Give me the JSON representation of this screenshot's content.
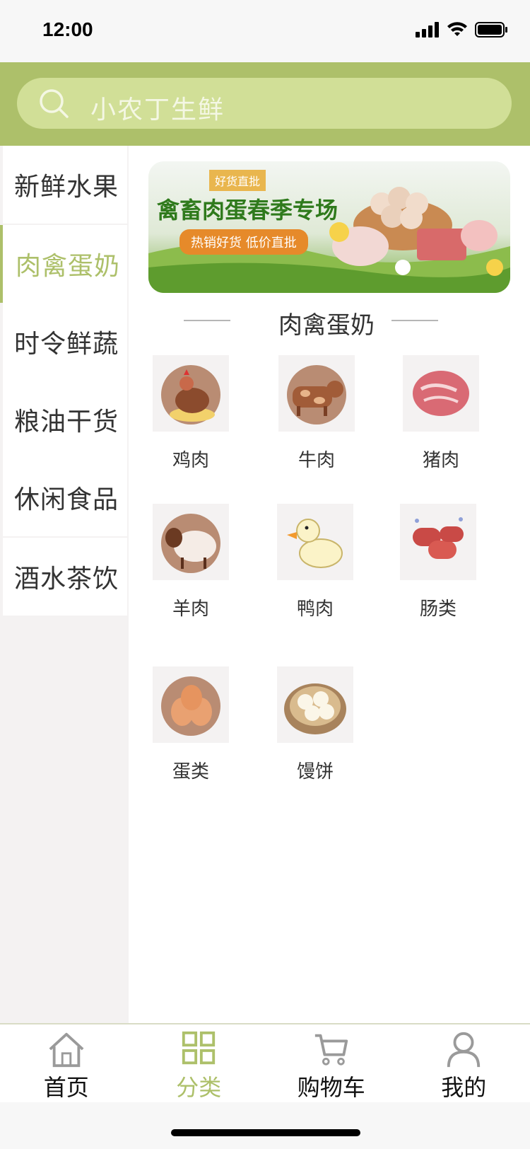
{
  "status": {
    "time": "12:00"
  },
  "search": {
    "placeholder": "小农丁生鲜"
  },
  "sidebar": {
    "items": [
      {
        "label": "新鲜水果",
        "active": false
      },
      {
        "label": "肉禽蛋奶",
        "active": true
      },
      {
        "label": "时令鲜蔬",
        "active": false
      },
      {
        "label": "粮油干货",
        "active": false
      },
      {
        "label": "休闲食品",
        "active": false
      },
      {
        "label": "酒水茶饮",
        "active": false
      }
    ]
  },
  "banner": {
    "tag": "好货直批",
    "title": "禽畜肉蛋春季专场",
    "subtitle": "热销好货 低价直批"
  },
  "section": {
    "title": "肉禽蛋奶"
  },
  "categories": [
    {
      "label": "鸡肉",
      "icon": "chicken-icon"
    },
    {
      "label": "牛肉",
      "icon": "cow-icon"
    },
    {
      "label": "猪肉",
      "icon": "pork-icon"
    },
    {
      "label": "羊肉",
      "icon": "sheep-icon"
    },
    {
      "label": "鸭肉",
      "icon": "duck-icon"
    },
    {
      "label": "肠类",
      "icon": "sausage-icon"
    },
    {
      "label": "蛋类",
      "icon": "eggs-icon"
    },
    {
      "label": "馒饼",
      "icon": "bun-icon"
    }
  ],
  "tabbar": {
    "items": [
      {
        "label": "首页",
        "icon": "home-icon",
        "active": false
      },
      {
        "label": "分类",
        "icon": "grid-icon",
        "active": true
      },
      {
        "label": "购物车",
        "icon": "cart-icon",
        "active": false
      },
      {
        "label": "我的",
        "icon": "user-icon",
        "active": false
      }
    ]
  },
  "colors": {
    "accent": "#adc06a",
    "search_bg": "#d1df97",
    "sidebar_bg": "#f4f2f2"
  }
}
